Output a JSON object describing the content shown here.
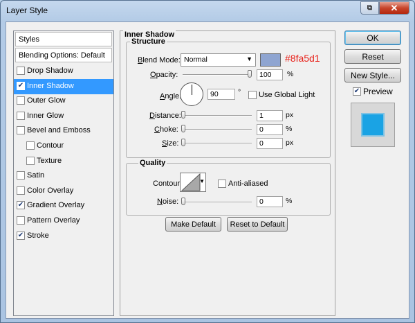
{
  "window": {
    "title": "Layer Style"
  },
  "styles_list": {
    "header": "Styles",
    "blending": "Blending Options: Default",
    "items": [
      {
        "label": "Drop Shadow",
        "checked": false
      },
      {
        "label": "Inner Shadow",
        "checked": true,
        "selected": true
      },
      {
        "label": "Outer Glow",
        "checked": false
      },
      {
        "label": "Inner Glow",
        "checked": false
      },
      {
        "label": "Bevel and Emboss",
        "checked": false
      },
      {
        "label": "Contour",
        "checked": false,
        "indent": true
      },
      {
        "label": "Texture",
        "checked": false,
        "indent": true
      },
      {
        "label": "Satin",
        "checked": false
      },
      {
        "label": "Color Overlay",
        "checked": false
      },
      {
        "label": "Gradient Overlay",
        "checked": true
      },
      {
        "label": "Pattern Overlay",
        "checked": false
      },
      {
        "label": "Stroke",
        "checked": true
      }
    ]
  },
  "panel": {
    "title": "Inner Shadow",
    "structure": {
      "title": "Structure",
      "blend_mode_label": "Blend Mode:",
      "blend_mode_value": "Normal",
      "color_hex": "#8fa5d1",
      "color_annotation": "#8fa5d1",
      "opacity_label": "Opacity:",
      "opacity_value": "100",
      "opacity_unit": "%",
      "opacity_level": 100,
      "angle_label": "Angle:",
      "angle_value": "90",
      "angle_unit": "°",
      "global_light_label": "Use Global Light",
      "global_light_checked": false,
      "distance_label": "Distance:",
      "distance_value": "1",
      "distance_unit": "px",
      "choke_label": "Choke:",
      "choke_value": "0",
      "choke_unit": "%",
      "size_label": "Size:",
      "size_value": "0",
      "size_unit": "px"
    },
    "quality": {
      "title": "Quality",
      "contour_label": "Contour:",
      "anti_aliased_label": "Anti-aliased",
      "anti_aliased_checked": false,
      "noise_label": "Noise:",
      "noise_value": "0",
      "noise_unit": "%"
    },
    "make_default": "Make Default",
    "reset_default": "Reset to Default"
  },
  "actions": {
    "ok": "OK",
    "reset": "Reset",
    "new_style": "New Style...",
    "preview_label": "Preview",
    "preview_checked": true
  },
  "colors": {
    "selection": "#3399ff",
    "annotation": "#e8211a",
    "preview_fill": "#1aa3e4"
  }
}
